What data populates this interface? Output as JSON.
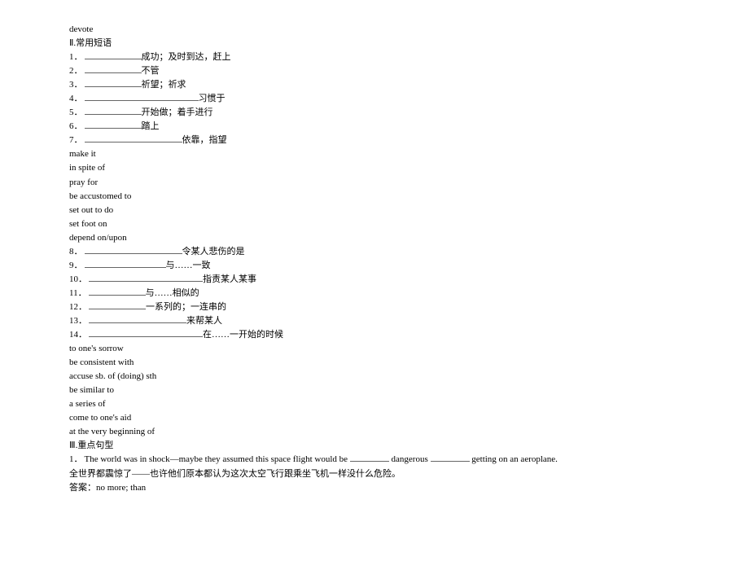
{
  "header": {
    "word": "devote",
    "section2_title": "Ⅱ.常用短语"
  },
  "items1": [
    {
      "num": "1．",
      "blank": "short",
      "text": "成功；及时到达，赶上"
    },
    {
      "num": "2．",
      "blank": "short",
      "text": "不管"
    },
    {
      "num": "3．",
      "blank": "short",
      "text": "祈望；祈求"
    },
    {
      "num": "4．",
      "blank": "xlong",
      "text": "习惯于"
    },
    {
      "num": "5．",
      "blank": "short",
      "text": "开始做；着手进行"
    },
    {
      "num": "6．",
      "blank": "short",
      "text": "踏上"
    },
    {
      "num": "7．",
      "blank": "long",
      "text": "依靠，指望"
    }
  ],
  "answers1": [
    "make it",
    "in spite of",
    "pray for",
    "be accustomed to",
    "set out to do",
    "set foot on",
    "depend on/upon"
  ],
  "items2": [
    {
      "num": "8．",
      "blank": "long",
      "text": "令某人悲伤的是"
    },
    {
      "num": "9．",
      "blank": "med",
      "text": "与……一致"
    },
    {
      "num": "10．",
      "blank": "xlong",
      "text": "指责某人某事"
    },
    {
      "num": "11．",
      "blank": "short",
      "text": "与……相似的"
    },
    {
      "num": "12．",
      "blank": "short",
      "text": "一系列的；一连串的"
    },
    {
      "num": "13．",
      "blank": "long",
      "text": "来帮某人"
    },
    {
      "num": "14．",
      "blank": "xlong",
      "text": "在……一开始的时候"
    }
  ],
  "answers2": [
    "to one's sorrow",
    "be consistent with",
    "accuse sb. of (doing) sth",
    "be similar to",
    "a series of",
    "come to one's aid",
    "at the very beginning of"
  ],
  "section3": {
    "title": "Ⅲ.重点句型",
    "sentence_num": "1．",
    "sentence_part1": "The world was in shock—maybe they assumed this space flight would be ",
    "sentence_part2": " dangerous ",
    "sentence_part3": " getting on an aeroplane.",
    "translation": "全世界都震惊了——也许他们原本都认为这次太空飞行跟乘坐飞机一样没什么危险。",
    "answer_label": "答案：",
    "answer_text": "no more; than"
  }
}
